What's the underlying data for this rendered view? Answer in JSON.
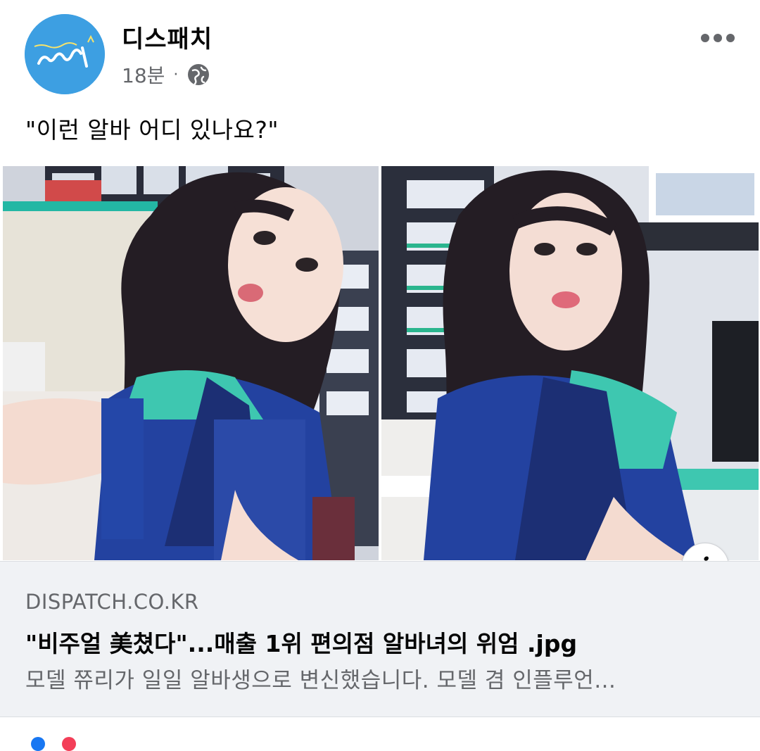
{
  "post": {
    "page_name": "디스패치",
    "time": "18분",
    "separator": "·",
    "privacy_icon": "globe-icon",
    "more_icon": "more-options-icon",
    "text": "\"이런 알바 어디 있나요?\""
  },
  "link": {
    "domain": "DISPATCH.CO.KR",
    "title": "\"비주얼 美쳤다\"...매출 1위 편의점 알바녀의 위엄 .jpg",
    "description": "모델 쮸리가 일일 알바생으로 변신했습니다. 모델 겸 인플루언...",
    "info_icon": "info-icon",
    "info_label": "i"
  },
  "colors": {
    "brand_blue": "#3d9fe2",
    "preview_bg": "#f0f2f5",
    "secondary_text": "#65676b",
    "uniform_teal": "#3ec7b0",
    "uniform_navy": "#1c2f74"
  }
}
